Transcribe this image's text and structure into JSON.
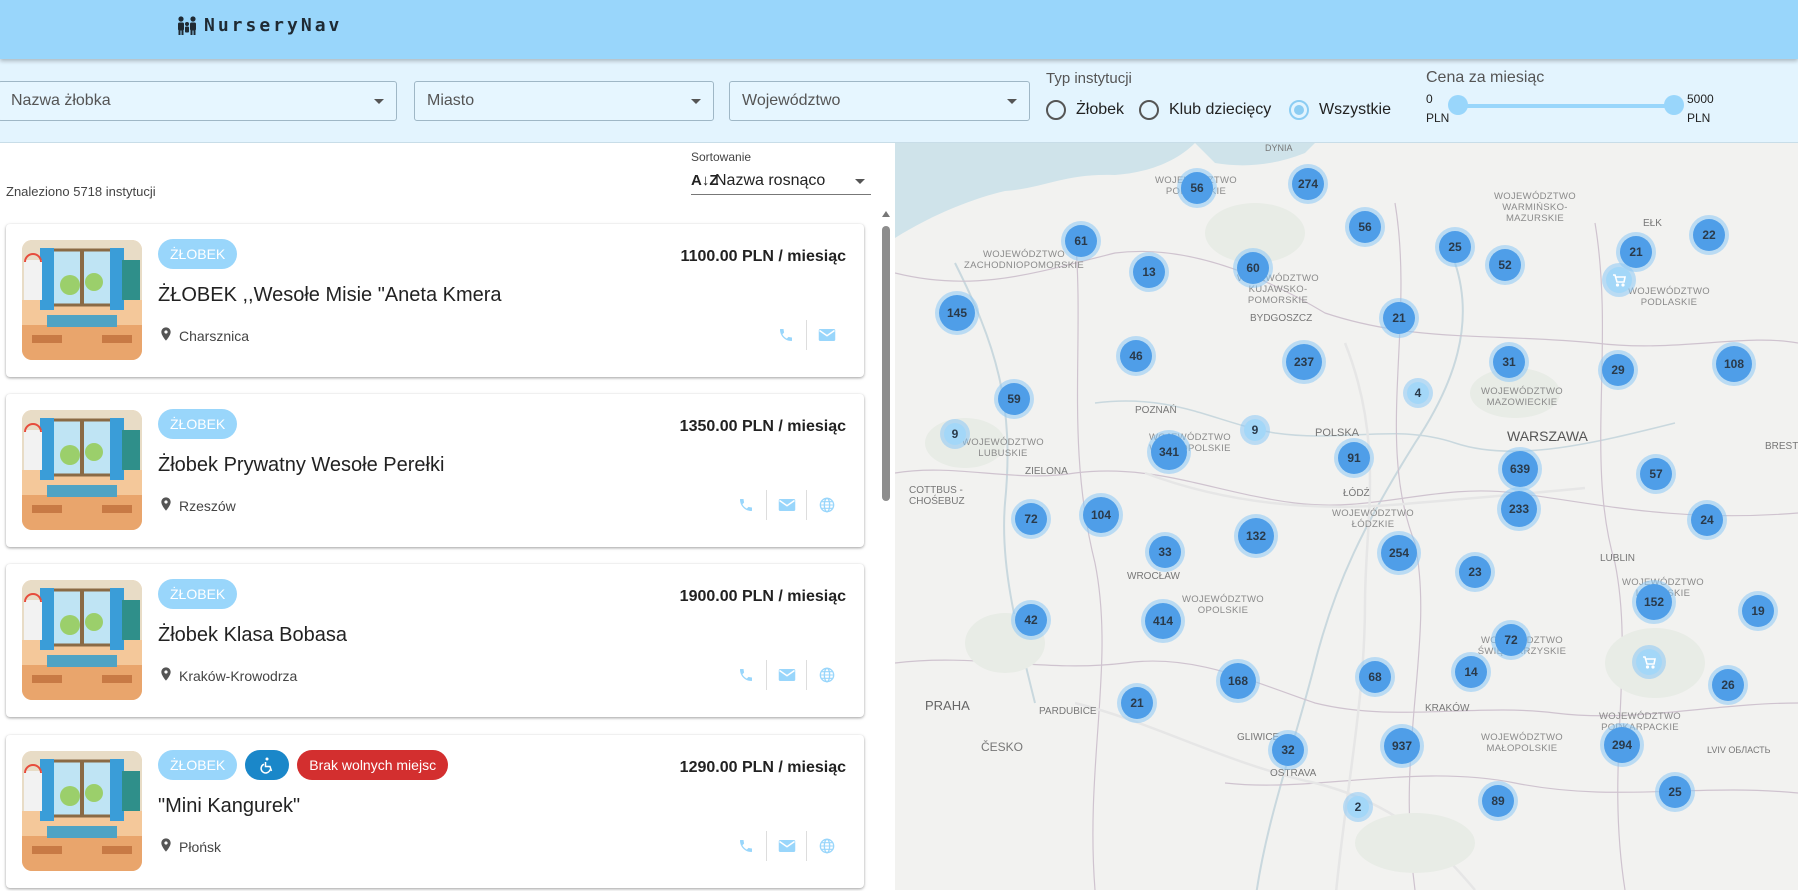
{
  "app": {
    "title": "NurseryNav"
  },
  "filters": {
    "name_placeholder": "Nazwa żłobka",
    "city_placeholder": "Miasto",
    "region_placeholder": "Województwo",
    "type_label": "Typ instytucji",
    "type_options": [
      "Żłobek",
      "Klub dziecięcy",
      "Wszystkie"
    ],
    "type_selected": "Wszystkie",
    "price_label": "Cena za miesiąc",
    "price_min": "0",
    "price_max": "5000",
    "price_unit": "PLN"
  },
  "list": {
    "found_text": "Znaleziono 5718 instytucji",
    "sort_caption": "Sortowanie",
    "sort_icon": "A↓Z",
    "sort_value": "Nazwa rosnąco",
    "items": [
      {
        "badge": "ŻŁOBEK",
        "price": "1100.00 PLN / miesiąc",
        "name": "ŻŁOBEK ,,Wesołe Misie \"Aneta Kmera",
        "city": "Charsznica"
      },
      {
        "badge": "ŻŁOBEK",
        "price": "1350.00 PLN / miesiąc",
        "name": "Żłobek Prywatny Wesołe Perełki",
        "city": "Rzeszów"
      },
      {
        "badge": "ŻŁOBEK",
        "price": "1900.00 PLN / miesiąc",
        "name": "Żłobek Klasa Bobasa",
        "city": "Kraków-Krowodrza"
      },
      {
        "badge": "ŻŁOBEK",
        "extra_badge": "Brak wolnych miejsc",
        "price": "1290.00 PLN / miesiąc",
        "name": "\"Mini Kangurek\"",
        "city": "Płońsk"
      }
    ]
  },
  "map": {
    "clusters": [
      "274",
      "56",
      "61",
      "13",
      "60",
      "56",
      "25",
      "52",
      "21",
      "22",
      "145",
      "21",
      "46",
      "237",
      "31",
      "29",
      "108",
      "59",
      "4",
      "9",
      "9",
      "341",
      "91",
      "639",
      "57",
      "72",
      "104",
      "132",
      "254",
      "233",
      "24",
      "33",
      "23",
      "152",
      "19",
      "42",
      "414",
      "72",
      "168",
      "68",
      "14",
      "21",
      "26",
      "32",
      "937",
      "294",
      "89",
      "25",
      "2"
    ],
    "regions": [
      "WOJEWÓDZTWO POMORSKIE",
      "WOJEWÓDZTWO WARMIŃSKO-MAZURSKIE",
      "WOJEWÓDZTWO ZACHODNIOPOMORSKIE",
      "WOJEWÓDZTWO KUJAWSKO-POMORSKIE",
      "WOJEWÓDZTWO PODLASKIE",
      "WOJEWÓDZTWO MAZOWIECKIE",
      "WOJEWÓDZTWO LUBUSKIE",
      "WOJEWÓDZTWO WIELKOPOLSKIE",
      "WOJEWÓDZTWO ŁÓDZKIE",
      "WOJEWÓDZTWO OPOLSKIE",
      "WOJEWÓDZTWO ŚWIĘTOKRZYSKIE",
      "WOJEWÓDZTWO LUBELSKIE",
      "WOJEWÓDZTWO MAŁOPOLSKIE",
      "WOJEWÓDZTWO PODKARPACKIE"
    ],
    "places": [
      "DYNIA",
      "EŁK",
      "BYDGOSZCZ",
      "POZNAŃ",
      "POLSKA",
      "WARSZAWA",
      "ZIELONA",
      "COTTBUS - CHOŚEBUZ",
      "ŁÓDŹ",
      "LUBLIN",
      "WROCŁAW",
      "BREST",
      "GLIWICE",
      "PRAHA",
      "PARDUBICE",
      "KRAKÓW",
      "OSTRAVA",
      "ČESKO",
      "LVIV ОБЛАСТЬ"
    ]
  }
}
